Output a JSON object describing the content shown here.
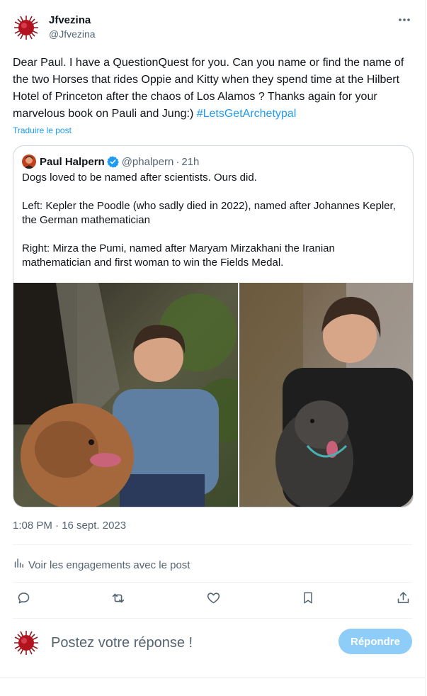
{
  "post": {
    "author_name": "Jfvezina",
    "author_handle": "@Jfvezina",
    "text": "Dear Paul. I have a QuestionQuest for you. Can you name or find the name of the two Horses that rides Oppie and Kitty when they spend time at the Hilbert Hotel of Princeton after the chaos of Los Alamos ? Thanks again for your marvelous book on Pauli and Jung:) ",
    "hashtag": "#LetsGetArchetypal",
    "translate_label": "Traduire le post",
    "timestamp": "1:08 PM · 16 sept. 2023"
  },
  "quoted_post": {
    "author_name": "Paul Halpern",
    "author_handle": "@phalpern",
    "separator": "·",
    "time": "21h",
    "text": "Dogs loved to be named after scientists.  Ours did.\n\nLeft:  Kepler the Poodle (who sadly died in 2022), named after Johannes Kepler, the German mathematician\n\nRight:  Mirza the Pumi, named after Maryam Mirzakhani the Iranian mathematician and first woman to win the Fields Medal."
  },
  "analytics": {
    "label": "Voir les engagements avec le post"
  },
  "actions": [
    {
      "name": "reply",
      "icon": "reply-icon"
    },
    {
      "name": "repost",
      "icon": "repost-icon"
    },
    {
      "name": "like",
      "icon": "heart-icon"
    },
    {
      "name": "bookmark",
      "icon": "bookmark-icon"
    },
    {
      "name": "share",
      "icon": "share-icon"
    }
  ],
  "reply": {
    "placeholder": "Postez votre réponse !",
    "button_label": "Répondre"
  },
  "colors": {
    "accent": "#1d9bf0",
    "reply_button_disabled": "#8ecdf8",
    "secondary_text": "#536471",
    "border": "#cfd9de"
  }
}
